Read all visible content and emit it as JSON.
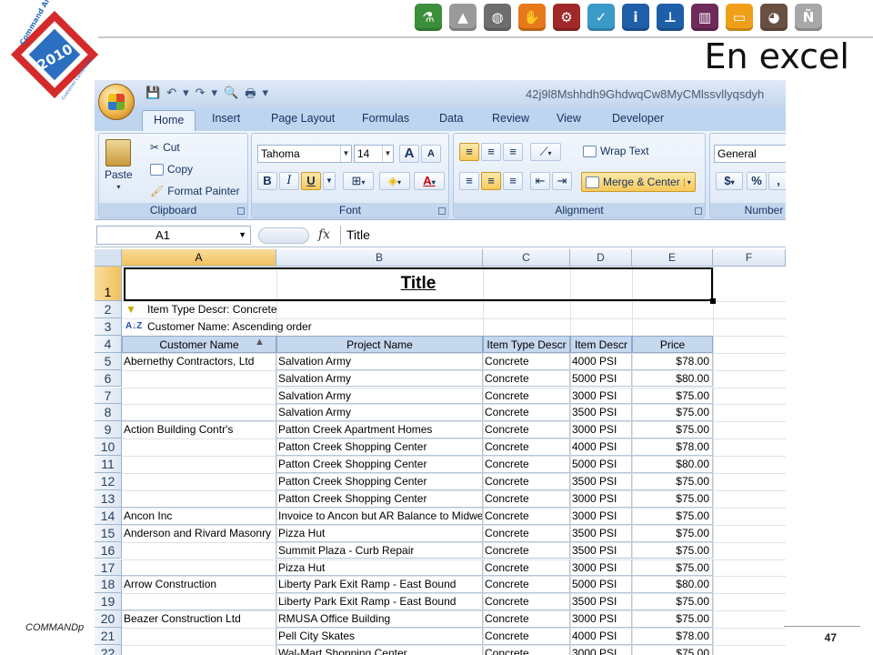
{
  "slide": {
    "title": "En excel",
    "footer_left": "COMMANDp",
    "page_number": "47",
    "logo": {
      "top_text": "Command Alkon",
      "year": "2010",
      "bottom_text": "Customer Conference"
    },
    "icons": [
      {
        "name": "flask-icon",
        "color": "#3b8f3b",
        "glyph": "⚗"
      },
      {
        "name": "scale-icon",
        "color": "#9a9a9a",
        "glyph": "▲"
      },
      {
        "name": "globe-icon",
        "color": "#6e6e6e",
        "glyph": "◍"
      },
      {
        "name": "hand-icon",
        "color": "#e8781c",
        "glyph": "✋"
      },
      {
        "name": "gears-icon",
        "color": "#a02828",
        "glyph": "⚙"
      },
      {
        "name": "checkmark-icon",
        "color": "#3a9ac8",
        "glyph": "✓"
      },
      {
        "name": "info-icon",
        "color": "#1f5fa8",
        "glyph": "i"
      },
      {
        "name": "stamp-icon",
        "color": "#1f5fa8",
        "glyph": "⊥"
      },
      {
        "name": "panels-icon",
        "color": "#6e2a5a",
        "glyph": "▥"
      },
      {
        "name": "window-icon",
        "color": "#f0a018",
        "glyph": "▭"
      },
      {
        "name": "truck-icon",
        "color": "#6a5040",
        "glyph": "◕"
      },
      {
        "name": "n-letter-icon",
        "color": "#a8a8a8",
        "glyph": "Ñ"
      }
    ]
  },
  "excel": {
    "doc_title": "42j9l8Mshhdh9GhdwqCw8MyCMlssvllyqsdyh",
    "tabs": [
      "Home",
      "Insert",
      "Page Layout",
      "Formulas",
      "Data",
      "Review",
      "View",
      "Developer"
    ],
    "active_tab": "Home",
    "ribbon": {
      "clipboard": {
        "label": "Clipboard",
        "paste": "Paste",
        "cut": "Cut",
        "copy": "Copy",
        "format_painter": "Format Painter"
      },
      "font": {
        "label": "Font",
        "font_name": "Tahoma",
        "font_size": "14",
        "bold": "B",
        "italic": "I",
        "underline": "U",
        "grow": "A",
        "shrink": "A",
        "font_color": "A"
      },
      "alignment": {
        "label": "Alignment",
        "wrap_text": "Wrap Text",
        "merge_center": "Merge & Center"
      },
      "number": {
        "label": "Number",
        "format": "General",
        "currency": "$",
        "percent": "%",
        "comma": ","
      }
    },
    "name_box": "A1",
    "fx": "fx",
    "formula": "Title",
    "columns": [
      "A",
      "B",
      "C",
      "D",
      "E",
      "F"
    ],
    "rows": [
      "1",
      "2",
      "3",
      "4",
      "5",
      "6",
      "7",
      "8",
      "9",
      "10",
      "11",
      "12",
      "13",
      "14",
      "15",
      "16",
      "17",
      "18",
      "19",
      "20",
      "21",
      "22"
    ],
    "sheet": {
      "title": "Title",
      "filter_line": "Item Type Descr: Concrete",
      "sort_line": "Customer Name: Ascending order",
      "headers": [
        "Customer Name",
        "Project Name",
        "Item Type Descr",
        "Item Descr",
        "Price"
      ],
      "data": [
        [
          "Abernethy Contractors, Ltd",
          "Salvation Army",
          "Concrete",
          "4000 PSI",
          "$78.00"
        ],
        [
          "",
          "Salvation Army",
          "Concrete",
          "5000 PSI",
          "$80.00"
        ],
        [
          "",
          "Salvation Army",
          "Concrete",
          "3000 PSI",
          "$75.00"
        ],
        [
          "",
          "Salvation Army",
          "Concrete",
          "3500 PSI",
          "$75.00"
        ],
        [
          "Action Building Contr's",
          "Patton Creek Apartment Homes",
          "Concrete",
          "3000 PSI",
          "$75.00"
        ],
        [
          "",
          "Patton Creek Shopping Center",
          "Concrete",
          "4000 PSI",
          "$78.00"
        ],
        [
          "",
          "Patton Creek Shopping Center",
          "Concrete",
          "5000 PSI",
          "$80.00"
        ],
        [
          "",
          "Patton Creek Shopping Center",
          "Concrete",
          "3500 PSI",
          "$75.00"
        ],
        [
          "",
          "Patton Creek Shopping Center",
          "Concrete",
          "3000 PSI",
          "$75.00"
        ],
        [
          "Ancon Inc",
          "Invoice to Ancon but AR Balance to Midwe",
          "Concrete",
          "3000 PSI",
          "$75.00"
        ],
        [
          "Anderson and Rivard Masonry",
          "Pizza Hut",
          "Concrete",
          "3500 PSI",
          "$75.00"
        ],
        [
          "",
          "Summit Plaza - Curb Repair",
          "Concrete",
          "3500 PSI",
          "$75.00"
        ],
        [
          "",
          "Pizza Hut",
          "Concrete",
          "3000 PSI",
          "$75.00"
        ],
        [
          "Arrow Construction",
          "Liberty Park Exit Ramp - East Bound",
          "Concrete",
          "5000 PSI",
          "$80.00"
        ],
        [
          "",
          "Liberty Park Exit Ramp - East Bound",
          "Concrete",
          "3500 PSI",
          "$75.00"
        ],
        [
          "Beazer Construction Ltd",
          "RMUSA Office Building",
          "Concrete",
          "3000 PSI",
          "$75.00"
        ],
        [
          "",
          "Pell City Skates",
          "Concrete",
          "4000 PSI",
          "$78.00"
        ],
        [
          "",
          "Wal-Mart Shopping Center",
          "Concrete",
          "3000 PSI",
          "$75.00"
        ]
      ]
    }
  }
}
